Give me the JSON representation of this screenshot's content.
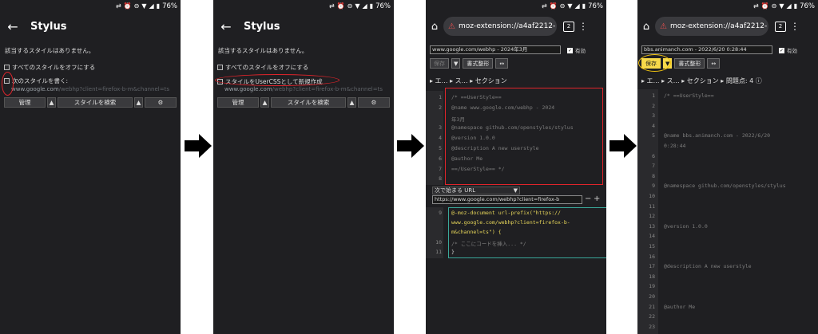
{
  "status": {
    "battery": "76%"
  },
  "panel1": {
    "title": "Stylus",
    "notice": "該当するスタイルはありません。",
    "disable_all": "すべてのスタイルをオフにする",
    "write_style": "次のスタイルを書く:",
    "url_site": "www.google.com",
    "url_rest": "/webhp?client=firefox-b-m&channel=ts",
    "manage_btn": "管理",
    "find_btn": "スタイルを検索"
  },
  "panel2": {
    "title": "Stylus",
    "notice": "該当するスタイルはありません。",
    "disable_all": "すべてのスタイルをオフにする",
    "write_usercss": "スタイルをUserCSSとして新規作成",
    "url_site": "www.google.com",
    "url_rest": "/webhp?client=firefox-b-m&channel=ts",
    "manage_btn": "管理",
    "find_btn": "スタイルを検索"
  },
  "panel3": {
    "url": "moz-extension://a4af2212-",
    "tabs_count": "2",
    "name_field": "www.google.com/webhp - 2024年3月",
    "enabled_label": "有効",
    "save_btn": "保存",
    "format_btn": "書式整形",
    "sections": "▸ エ… ▸ ス… ▸ セクション",
    "code_top": [
      {
        "n": "1",
        "t": "/* ==UserStyle=="
      },
      {
        "n": "2",
        "t": "@name          www.google.com/webhp - 2024"
      },
      {
        "n": "",
        "t": "年3月"
      },
      {
        "n": "3",
        "t": "@namespace     github.com/openstyles/stylus"
      },
      {
        "n": "4",
        "t": "@version       1.0.0"
      },
      {
        "n": "5",
        "t": "@description   A new userstyle"
      },
      {
        "n": "6",
        "t": "@author        Me"
      },
      {
        "n": "7",
        "t": "==/UserStyle== */"
      },
      {
        "n": "8",
        "t": ""
      }
    ],
    "applies_label": "次で始まる URL",
    "applies_value": "https://www.google.com/webhp?client=firefox-b",
    "code_bottom": [
      {
        "n": "9",
        "t": "@-moz-document url-prefix(\"https://"
      },
      {
        "n": "",
        "t": "www.google.com/webhp?client=firefox-b-"
      },
      {
        "n": "",
        "t": "m&channel=ts\") {"
      },
      {
        "n": "10",
        "t": "    /* ここにコードを挿入... */"
      },
      {
        "n": "11",
        "t": "}"
      }
    ]
  },
  "panel4": {
    "url": "moz-extension://a4af2212-",
    "tabs_count": "2",
    "name_field": "bbs.animanch.com - 2022/6/20 0:28:44",
    "enabled_label": "有効",
    "save_btn": "保存",
    "format_btn": "書式整形",
    "sections": "▸ エ… ▸ ス… ▸ セクション ▸ 問題点: 4 ⓘ",
    "code": [
      {
        "n": "1",
        "t": "/* ==UserStyle=="
      },
      {
        "n": "2",
        "t": ""
      },
      {
        "n": "3",
        "t": ""
      },
      {
        "n": "4",
        "t": ""
      },
      {
        "n": "5",
        "t": "@name        bbs.animanch.com - 2022/6/20"
      },
      {
        "n": "",
        "t": "0:28:44"
      },
      {
        "n": "6",
        "t": ""
      },
      {
        "n": "7",
        "t": ""
      },
      {
        "n": "8",
        "t": ""
      },
      {
        "n": "9",
        "t": "@namespace     github.com/openstyles/stylus"
      },
      {
        "n": "10",
        "t": ""
      },
      {
        "n": "11",
        "t": ""
      },
      {
        "n": "12",
        "t": ""
      },
      {
        "n": "13",
        "t": "@version      1.0.0"
      },
      {
        "n": "14",
        "t": ""
      },
      {
        "n": "15",
        "t": ""
      },
      {
        "n": "16",
        "t": ""
      },
      {
        "n": "17",
        "t": "@description    A new userstyle"
      },
      {
        "n": "18",
        "t": ""
      },
      {
        "n": "19",
        "t": ""
      },
      {
        "n": "20",
        "t": ""
      },
      {
        "n": "21",
        "t": "@author       Me"
      },
      {
        "n": "22",
        "t": ""
      },
      {
        "n": "23",
        "t": ""
      }
    ]
  }
}
